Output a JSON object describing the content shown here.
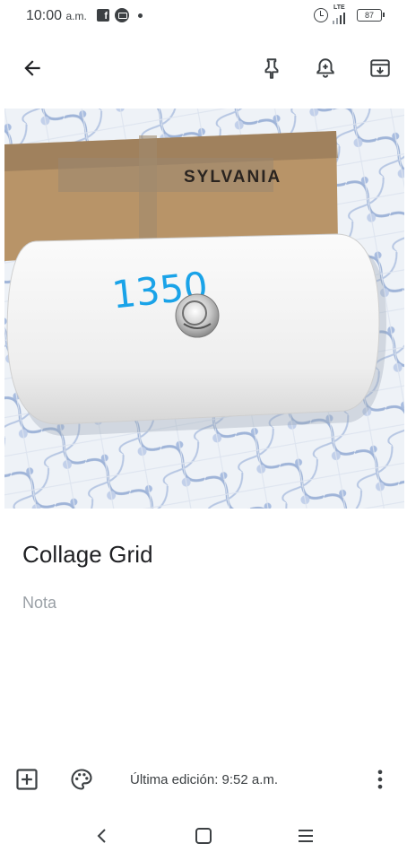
{
  "status_bar": {
    "time": "10:00",
    "ampm": "a.m.",
    "network_label": "LTE",
    "battery_level": "87",
    "icons": [
      "facebook-icon",
      "messenger-icon",
      "notification-dot-icon",
      "alarm-icon",
      "signal-icon",
      "battery-icon"
    ]
  },
  "toolbar": {
    "icons": [
      "back-arrow-icon",
      "pin-icon",
      "reminder-bell-icon",
      "archive-icon"
    ]
  },
  "photo": {
    "box_brand_text": "SYLVANIA",
    "handwritten_number": "1350"
  },
  "note": {
    "title": "Collage Grid",
    "body_placeholder": "Nota"
  },
  "bottom_bar": {
    "edit_status": "Última edición: 9:52 a.m.",
    "icons": [
      "add-box-icon",
      "palette-icon",
      "more-vertical-icon"
    ]
  },
  "nav_bar": {
    "icons": [
      "nav-back-icon",
      "nav-home-icon",
      "nav-recents-icon"
    ]
  },
  "colors": {
    "text_primary": "#202124",
    "text_secondary": "#9aa0a6",
    "icon": "#3c4043",
    "handwriting": "#1aa3e8"
  }
}
